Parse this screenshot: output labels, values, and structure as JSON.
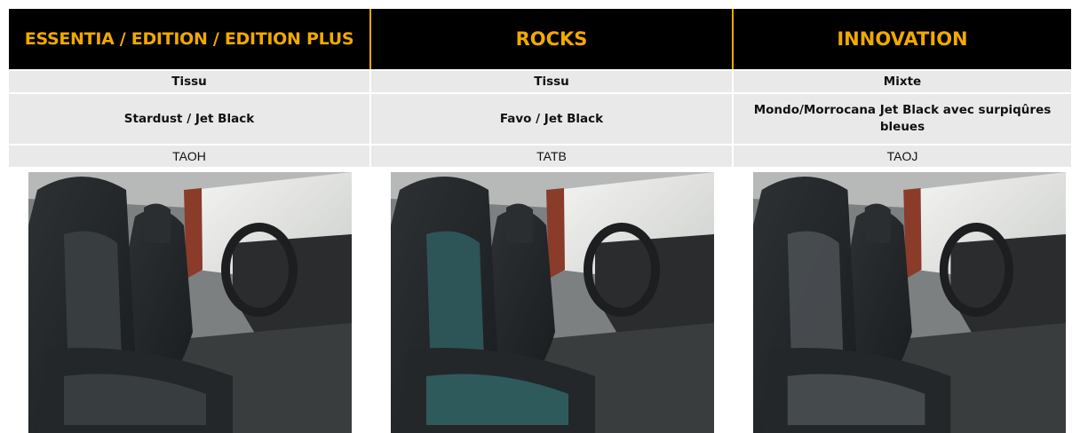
{
  "columns": [
    {
      "header": "ESSENTIA / EDITION / EDITION PLUS",
      "material": "Tissu",
      "color_name": "Stardust / Jet Black",
      "code": "TAOH",
      "photo_icon": "car-seat-photo"
    },
    {
      "header": "ROCKS",
      "material": "Tissu",
      "color_name": "Favo / Jet Black",
      "code": "TATB",
      "photo_icon": "car-seat-photo"
    },
    {
      "header": "INNOVATION",
      "material": "Mixte",
      "color_name": "Mondo/Morrocana Jet Black avec surpiqûres bleues",
      "code": "TAOJ",
      "photo_icon": "car-seat-photo"
    }
  ],
  "colors": {
    "header_bg": "#000000",
    "header_text": "#f2a900",
    "row_bg": "#e9e9e9",
    "divider": "#f2a900"
  }
}
